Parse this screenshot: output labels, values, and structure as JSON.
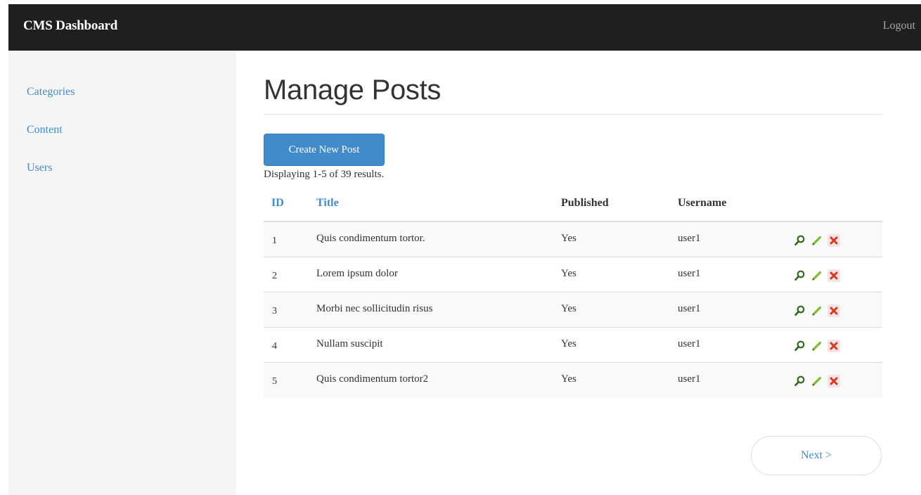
{
  "navbar": {
    "brand": "CMS Dashboard",
    "logout": "Logout"
  },
  "sidebar": {
    "items": [
      {
        "label": "Categories"
      },
      {
        "label": "Content"
      },
      {
        "label": "Users"
      }
    ]
  },
  "main": {
    "title": "Manage Posts",
    "create_button": "Create New Post",
    "summary": "Displaying 1-5 of 39 results.",
    "table": {
      "headers": {
        "id": "ID",
        "title": "Title",
        "published": "Published",
        "username": "Username"
      },
      "rows": [
        {
          "id": "1",
          "title": "Quis condimentum tortor.",
          "published": "Yes",
          "username": "user1"
        },
        {
          "id": "2",
          "title": "Lorem ipsum dolor",
          "published": "Yes",
          "username": "user1"
        },
        {
          "id": "3",
          "title": "Morbi nec sollicitudin risus",
          "published": "Yes",
          "username": "user1"
        },
        {
          "id": "4",
          "title": "Nullam suscipit",
          "published": "Yes",
          "username": "user1"
        },
        {
          "id": "5",
          "title": "Quis condimentum tortor2",
          "published": "Yes",
          "username": "user1"
        }
      ],
      "row_actions": [
        "magnifier-view-icon",
        "pencil-edit-icon",
        "cross-delete-icon"
      ]
    },
    "pager": {
      "next": "Next >"
    }
  },
  "colors": {
    "navbar_bg": "#1f1f1f",
    "sidebar_bg": "#f5f5f5",
    "link": "#428bca",
    "button_bg": "#428bca",
    "row_stripe": "#f9f9f9"
  }
}
